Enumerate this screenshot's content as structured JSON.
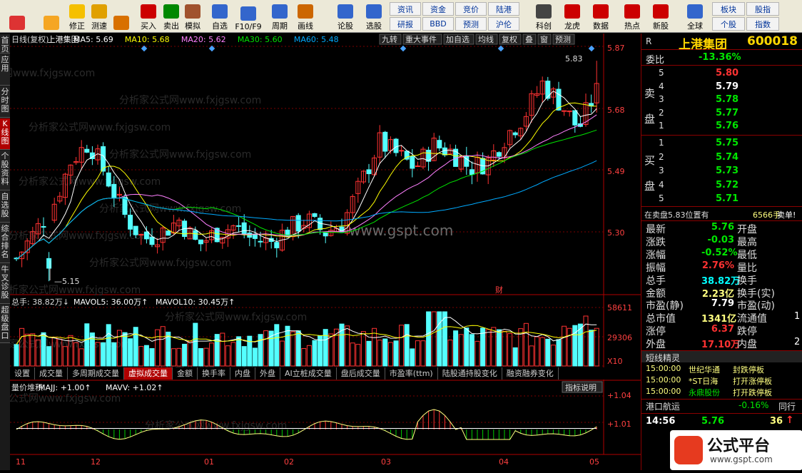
{
  "toolbar": {
    "buttons": [
      {
        "label": "",
        "icon": "colorful-grid-icon"
      },
      {
        "label": "",
        "icon": "back-arrow-icon"
      },
      {
        "label": "修正",
        "icon": "up-down-arrows-icon"
      },
      {
        "label": "测速",
        "icon": "smiley-icon"
      },
      {
        "label": "",
        "icon": "clock-icon"
      },
      {
        "label": "买入",
        "icon": "buy-icon"
      },
      {
        "label": "卖出",
        "icon": "sell-icon"
      },
      {
        "label": "模拟",
        "icon": "hammer-icon"
      },
      {
        "label": "自选",
        "icon": "star-icon"
      },
      {
        "label": "F10/F9",
        "icon": "f10-icon"
      },
      {
        "label": "周期",
        "icon": "period-icon"
      },
      {
        "label": "画线",
        "icon": "pen-icon"
      },
      {
        "label": "论股",
        "icon": "discuss-icon"
      },
      {
        "label": "选股",
        "icon": "select-stock-icon"
      },
      {
        "label": "科创",
        "icon": "kechuang-icon"
      },
      {
        "label": "龙虎",
        "icon": "dragon-tiger-icon"
      },
      {
        "label": "数据",
        "icon": "pe-data-icon"
      },
      {
        "label": "热点",
        "icon": "hotspot-icon"
      },
      {
        "label": "新股",
        "icon": "new-stock-icon"
      },
      {
        "label": "全球",
        "icon": "globe-icon"
      }
    ],
    "small": [
      [
        "资讯",
        "资金",
        "竞价",
        "陆港"
      ],
      [
        "研报",
        "BBD",
        "预测",
        "沪伦"
      ]
    ],
    "right_small": [
      [
        "板块",
        "股指"
      ],
      [
        "个股",
        "指数"
      ]
    ]
  },
  "left_tabs": [
    "首页",
    "应用",
    "分时图",
    "K线图",
    "个股资料",
    "自选股",
    "综合排名",
    "牛叉诊股",
    "超级盘口"
  ],
  "chart": {
    "header": {
      "period": "日线(复权)",
      "name": "上港集团",
      "ma5": "MA5: 5.69",
      "ma10": "MA10: 5.68",
      "ma20": "MA20: 5.62",
      "ma30": "MA30: 5.60",
      "ma60": "MA60: 5.48"
    },
    "menu": [
      "九转",
      "重大事件",
      "加自选",
      "均线",
      "复权",
      "叠",
      "窗",
      "预测"
    ],
    "price_ticks": [
      "5.87",
      "5.68",
      "5.49",
      "5.30"
    ],
    "high_label": "5.83",
    "low_label": "5.15",
    "cai": "财",
    "watermark": "www.gspt.com",
    "watermark_repeat": "分析家公式网www.fxjgsw.com",
    "vol_header": {
      "total": "总手: 38.82万↓",
      "mavol5": "MAVOL5: 36.00万↑",
      "mavol10": "MAVOL10: 30.45万↑"
    },
    "vol_ticks": [
      "58611",
      "29306",
      "X10"
    ],
    "tabs": [
      "设置",
      "成交量",
      "多周期成交量",
      "虚拟成交量",
      "金额",
      "换手率",
      "内盘",
      "外盘",
      "AI立桩成交量",
      "盘后成交量",
      "市盈率(ttm)",
      "陆股通持股变化",
      "融资融券变化"
    ],
    "active_tab": "虚拟成交量",
    "ind_header": {
      "name": "量价堆积",
      "majj": "MAJJ: +1.00↑",
      "mavv": "MAVV: +1.02↑"
    },
    "ind_button": "指标说明",
    "ind_ticks": [
      "+1.04",
      "+1.01"
    ],
    "x_labels": [
      "11",
      "12",
      "01",
      "02",
      "03",
      "04",
      "05"
    ]
  },
  "chart_data": {
    "type": "candlestick",
    "title": "上港集团 600018 日线(复权)",
    "ylim": [
      5.12,
      5.9
    ],
    "last_close": 5.76,
    "high": 5.83,
    "low": 5.15,
    "ma": {
      "MA5": 5.69,
      "MA10": 5.68,
      "MA20": 5.62,
      "MA30": 5.6,
      "MA60": 5.48
    },
    "volume_total": "38.82万",
    "mavol5": "36.00万",
    "mavol10": "30.45万"
  },
  "quote": {
    "r": "R",
    "name": "上港集团",
    "code": "600018",
    "weibi_label": "委比",
    "weibi": "-13.36%",
    "sell_group": "卖盘",
    "buy_group": "买盘",
    "sell": [
      [
        "5",
        "5.80"
      ],
      [
        "4",
        "5.79"
      ],
      [
        "3",
        "5.78"
      ],
      [
        "2",
        "5.77"
      ],
      [
        "1",
        "5.76"
      ]
    ],
    "buy": [
      [
        "1",
        "5.75"
      ],
      [
        "2",
        "5.74"
      ],
      [
        "3",
        "5.73"
      ],
      [
        "4",
        "5.72"
      ],
      [
        "5",
        "5.71"
      ]
    ],
    "bigorder": "在卖盘5.83位置有",
    "bigorder_vol": "6566手",
    "bigorder_tag": "卖单!",
    "stats": [
      [
        "最新",
        "5.76",
        "开盘",
        ""
      ],
      [
        "涨跌",
        "-0.03",
        "最高",
        ""
      ],
      [
        "涨幅",
        "-0.52%",
        "最低",
        ""
      ],
      [
        "振幅",
        "2.76%",
        "量比",
        ""
      ],
      [
        "总手",
        "38.82万",
        "换手",
        ""
      ],
      [
        "金额",
        "2.23亿",
        "换手(实)",
        ""
      ],
      [
        "市盈(静)",
        "7.79",
        "市盈(动)",
        ""
      ],
      [
        "总市值",
        "1341亿",
        "流通值",
        "1"
      ],
      [
        "涨停",
        "6.37",
        "跌停",
        ""
      ],
      [
        "外盘",
        "17.10万",
        "内盘",
        "2"
      ]
    ],
    "short_title": "短线精灵",
    "short": [
      [
        "15:00:00",
        "世纪华通",
        "封跌停板"
      ],
      [
        "15:00:00",
        "*ST日海",
        "打开涨停板"
      ],
      [
        "15:00:00",
        "永鼎股份",
        "打开跌停板"
      ]
    ],
    "port_title": "港口航运",
    "port_pct": "-0.16%",
    "port_more": "同行",
    "tick_time": "14:56",
    "tick_price": "5.76",
    "tick_vol": "36",
    "tick_arrow": "↑",
    "logo_text": "公式平台",
    "logo_url": "www.gspt.com"
  },
  "colors": {
    "up": "#ff3232",
    "down": "#54ffff",
    "bg": "#000000",
    "ma5": "#ffffff",
    "ma10": "#ffff00",
    "ma20": "#ff80ff",
    "ma30": "#00e600",
    "ma60": "#00aaff"
  }
}
